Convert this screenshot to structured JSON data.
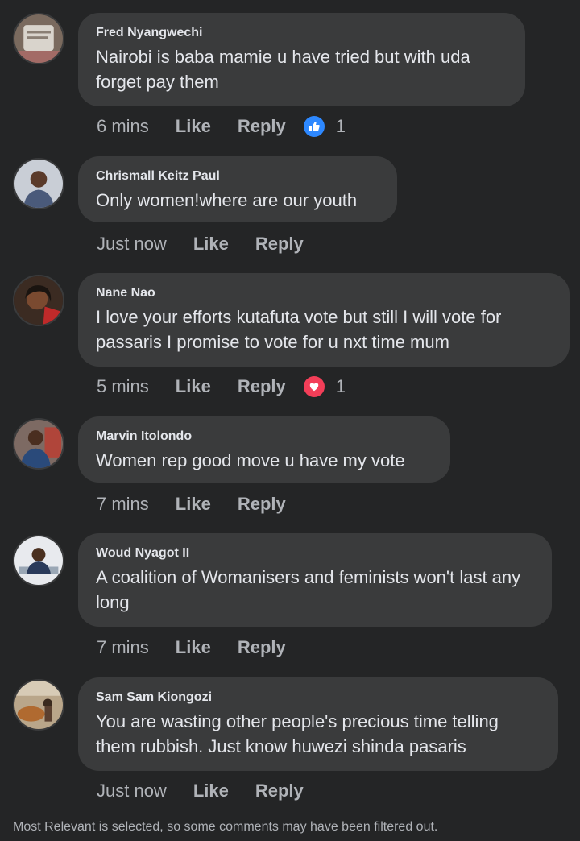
{
  "comments": [
    {
      "author": "Fred Nyangwechi",
      "text": "Nairobi is baba mamie u have tried but with uda forget pay them",
      "time": "6 mins",
      "like": "Like",
      "reply": "Reply",
      "reaction": "like",
      "reaction_count": "1"
    },
    {
      "author": "Chrismall Keitz Paul",
      "text": "Only women!where are our youth",
      "time": "Just now",
      "like": "Like",
      "reply": "Reply"
    },
    {
      "author": "Nane Nao",
      "text": "I love your efforts kutafuta vote but still I will vote for passaris I promise to vote for u nxt time mum",
      "time": "5 mins",
      "like": "Like",
      "reply": "Reply",
      "reaction": "love",
      "reaction_count": "1"
    },
    {
      "author": "Marvin Itolondo",
      "text": "Women rep good move u have my vote",
      "time": "7 mins",
      "like": "Like",
      "reply": "Reply"
    },
    {
      "author": "Woud Nyagot II",
      "text": "A coalition of Womanisers and feminists won't last any long",
      "time": "7 mins",
      "like": "Like",
      "reply": "Reply"
    },
    {
      "author": "Sam Sam Kiongozi",
      "text": "You are wasting other people's precious time telling them rubbish. Just know huwezi shinda pasaris",
      "time": "Just now",
      "like": "Like",
      "reply": "Reply"
    }
  ],
  "footer": {
    "note": "Most Relevant is selected, so some comments may have been filtered out."
  },
  "colors": {
    "background": "#242526",
    "bubble": "#3a3b3c",
    "like_blue": "#2d88ff",
    "love_red": "#f33e58"
  }
}
